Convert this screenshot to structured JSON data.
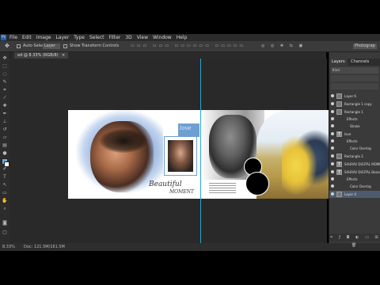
{
  "app": {
    "logo": "Ps",
    "menus": [
      "File",
      "Edit",
      "Image",
      "Layer",
      "Type",
      "Select",
      "Filter",
      "3D",
      "View",
      "Window",
      "Help"
    ],
    "workspace": "Photograp"
  },
  "options": {
    "auto_select_label": "Auto-Select:",
    "auto_select_value": "Layer",
    "transform_label": "Show Transform Controls"
  },
  "document": {
    "tab_label": "ed @ 8.33% (RGB/8)",
    "zoom": "8.33%",
    "doc_size": "Doc: 121.5M/161.5M"
  },
  "artwork": {
    "love_text": "love",
    "beautiful_text": "Beautiful",
    "moment_text": "MOMENT"
  },
  "layers_panel": {
    "tabs": [
      "Layers",
      "Channels"
    ],
    "filter_label": "Kind",
    "layers": [
      {
        "name": "Layer 6",
        "sub": false
      },
      {
        "name": "Rectangle 1 copy",
        "sub": false
      },
      {
        "name": "Rectangle 1",
        "sub": false
      },
      {
        "name": "Effects",
        "sub": true
      },
      {
        "name": "Stroke",
        "sub": true
      },
      {
        "name": "love",
        "sub": false
      },
      {
        "name": "Effects",
        "sub": true
      },
      {
        "name": "Color Overlay",
        "sub": true
      },
      {
        "name": "Rectangle 2",
        "sub": false
      },
      {
        "name": "SAURAV DIGITAL MOMENT",
        "sub": false
      },
      {
        "name": "SAURAV DIGITAL Beautiful",
        "sub": false
      },
      {
        "name": "Effects",
        "sub": true
      },
      {
        "name": "Color Overlay",
        "sub": true
      },
      {
        "name": "Layer 4",
        "sub": false
      }
    ]
  }
}
